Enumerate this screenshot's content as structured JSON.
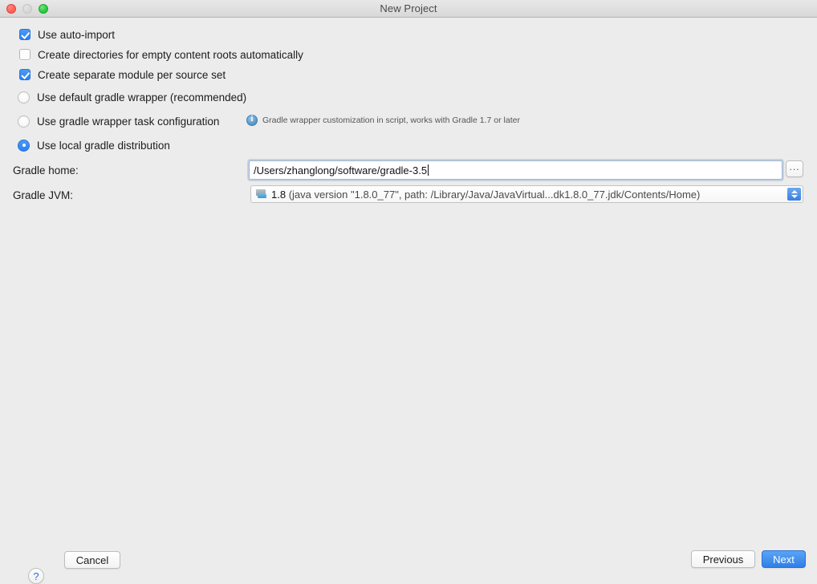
{
  "window": {
    "title": "New Project",
    "traffic_lights": [
      "close-button",
      "minimize-button",
      "maximize-button"
    ]
  },
  "options": {
    "checkboxes": [
      {
        "label": "Use auto-import",
        "checked": true
      },
      {
        "label": "Create directories for empty content roots automatically",
        "checked": false
      },
      {
        "label": "Create separate module per source set",
        "checked": true
      }
    ],
    "radios": [
      {
        "label": "Use default gradle wrapper (recommended)",
        "selected": false
      },
      {
        "label": "Use gradle wrapper task configuration",
        "selected": false
      },
      {
        "label": "Use local gradle distribution",
        "selected": true
      }
    ],
    "hint": {
      "icon": "info-icon",
      "text": "Gradle wrapper customization in script, works with Gradle 1.7 or later"
    }
  },
  "form": {
    "gradle_home": {
      "label": "Gradle home:",
      "value": "/Users/zhanglong/software/gradle-3.5",
      "placeholder": "",
      "browse_label": "..."
    },
    "gradle_jvm": {
      "label": "Gradle JVM:",
      "icon": "jdk-icon",
      "version": "1.8",
      "details": " (java version \"1.8.0_77\", path: /Library/Java/JavaVirtual...dk1.8.0_77.jdk/Contents/Home)"
    }
  },
  "footer": {
    "help_label": "?",
    "cancel_label": "Cancel",
    "previous_label": "Previous",
    "next_label": "Next"
  },
  "colors": {
    "accent": "#2d7ff0",
    "window_bg": "#ececec",
    "titlebar": "#e0e0e0",
    "close": "#ff5f57",
    "minimize": "#d6d6d6",
    "maximize": "#28c840"
  }
}
